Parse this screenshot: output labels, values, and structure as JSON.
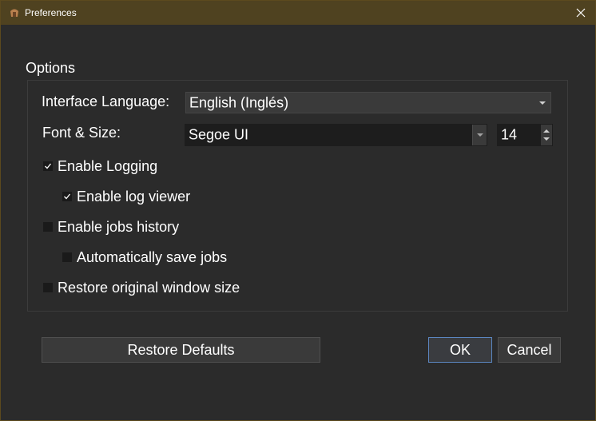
{
  "window": {
    "title": "Preferences"
  },
  "options": {
    "group_title": "Options",
    "interface_language_label": "Interface Language:",
    "interface_language_value": "English (Inglés)",
    "font_size_label": "Font & Size:",
    "font_value": "Segoe UI",
    "size_value": "14",
    "checkboxes": [
      {
        "label": "Enable Logging",
        "checked": true
      },
      {
        "label": "Enable log viewer",
        "checked": true
      },
      {
        "label": "Enable jobs history",
        "checked": false
      },
      {
        "label": "Automatically save jobs",
        "checked": false
      },
      {
        "label": "Restore original window size",
        "checked": false
      }
    ]
  },
  "buttons": {
    "restore_defaults": "Restore Defaults",
    "ok": "OK",
    "cancel": "Cancel"
  },
  "colors": {
    "titlebar": "#4f4220",
    "background": "#2b2b2b",
    "default_button_border": "#5b86c0"
  },
  "icons": {
    "app": "app-icon",
    "close": "close-icon",
    "check": "checkmark-icon",
    "dropdown": "chevron-down-icon",
    "spin_up": "arrow-up-icon",
    "spin_down": "arrow-down-icon"
  }
}
